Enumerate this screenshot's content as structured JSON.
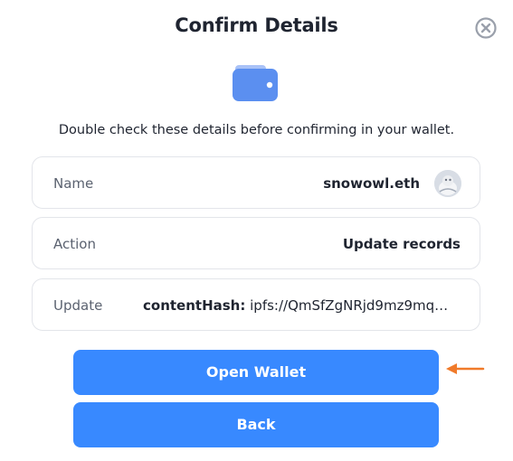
{
  "dialog": {
    "title": "Confirm Details",
    "subtitle": "Double check these details before confirming in your wallet.",
    "icons": {
      "close": "close-circle-icon",
      "wallet": "wallet-icon",
      "annotation": "arrow-left-icon"
    }
  },
  "details": [
    {
      "label": "Name",
      "value": "snowowl.eth"
    },
    {
      "label": "Action",
      "value": "Update records"
    },
    {
      "label": "Update",
      "key": "contentHash:",
      "value": "ipfs://QmSfZgNRjd9mz9mqT..."
    }
  ],
  "buttons": {
    "open_wallet": "Open Wallet",
    "back": "Back"
  },
  "colors": {
    "primary": "#3889ff",
    "wallet_icon": "#5b8ff0",
    "annotation_arrow": "#f07a2a",
    "border": "#e3e5ea"
  }
}
